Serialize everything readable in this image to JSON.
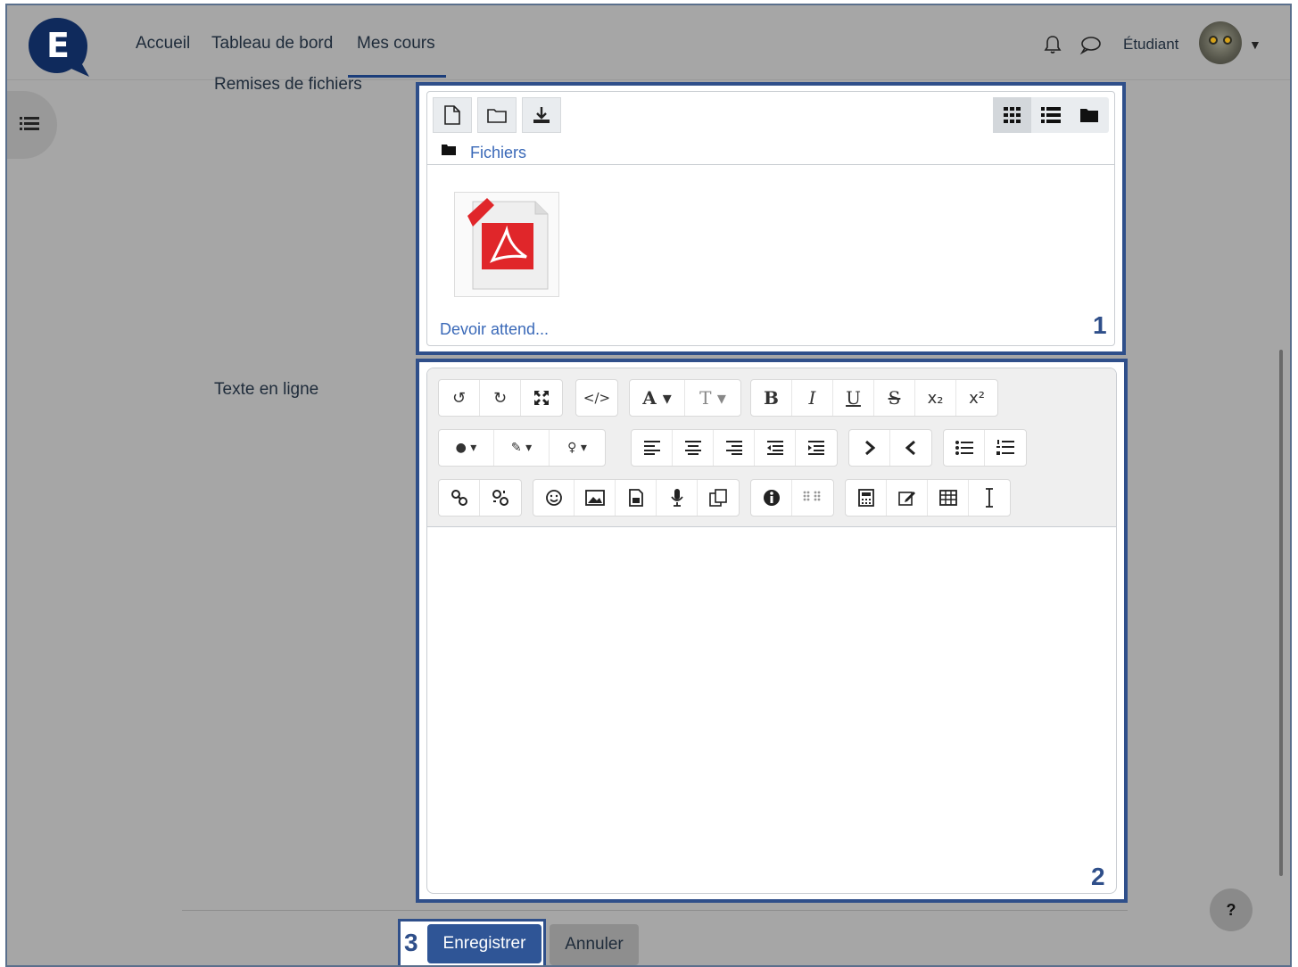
{
  "nav": {
    "links": [
      "Accueil",
      "Tableau de bord",
      "Mes cours"
    ],
    "user_label": "Étudiant"
  },
  "form": {
    "file_submissions_label": "Remises de fichiers",
    "online_text_label": "Texte en ligne"
  },
  "filemanager": {
    "path_label": "Fichiers",
    "file_name": "Devoir attend...",
    "callout": "1"
  },
  "editor": {
    "callout": "2",
    "toolbar_row1": [
      "↺",
      "↻",
      "✕",
      "</>",
      "A ▾",
      "T ▾",
      "B",
      "I",
      "U",
      "S",
      "x₂",
      "x²"
    ],
    "toolbar_row2": [
      "● ▾",
      "✎ ▾",
      "♀ ▾"
    ]
  },
  "actions": {
    "save_label": "Enregistrer",
    "cancel_label": "Annuler",
    "callout": "3",
    "help_label": "?"
  },
  "colors": {
    "callout_blue": "#2f4f8a",
    "link_blue": "#3a69b8",
    "primary": "#2f5596"
  }
}
